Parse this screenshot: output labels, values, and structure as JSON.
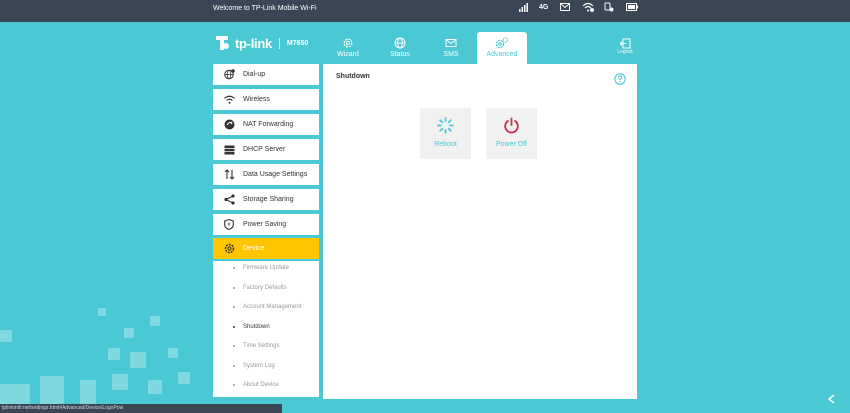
{
  "topbar": {
    "welcome": "Welcome to TP-Link Mobile Wi-Fi",
    "network": "4G",
    "icons": [
      "signal-icon",
      "mail-icon",
      "wifi-icon",
      "battery-icon"
    ]
  },
  "header": {
    "brand": "tp-link",
    "model": "M7650",
    "tabs": [
      {
        "label": "Wizard",
        "icon": "gear-icon"
      },
      {
        "label": "Status",
        "icon": "globe-icon"
      },
      {
        "label": "SMS",
        "icon": "envelope-icon"
      },
      {
        "label": "Advanced",
        "icon": "gears-icon",
        "active": true
      }
    ],
    "logout": "Logout"
  },
  "sidebar": {
    "items": [
      {
        "label": "Dial-up",
        "icon": "dialup-icon"
      },
      {
        "label": "Wireless",
        "icon": "wifi-icon"
      },
      {
        "label": "NAT Forwarding",
        "icon": "nat-icon"
      },
      {
        "label": "DHCP Server",
        "icon": "server-icon"
      },
      {
        "label": "Data Usage Settings",
        "icon": "data-arrows-icon"
      },
      {
        "label": "Storage Sharing",
        "icon": "share-icon"
      },
      {
        "label": "Power Saving",
        "icon": "shield-icon"
      },
      {
        "label": "Device",
        "icon": "gear-icon",
        "active": true
      }
    ],
    "submenu": [
      {
        "label": "Firmware Update"
      },
      {
        "label": "Factory Defaults"
      },
      {
        "label": "Account Management"
      },
      {
        "label": "Shutdown",
        "current": true
      },
      {
        "label": "Time Settings"
      },
      {
        "label": "System Log"
      },
      {
        "label": "About Device"
      }
    ]
  },
  "main": {
    "title": "Shutdown",
    "reboot_label": "Reboot",
    "poweroff_label": "Power Off"
  },
  "statusbar": {
    "url": "tplinkmifi.net/settings.html#Advanced/Device/LogoPow"
  },
  "colors": {
    "background": "#4ac8d3",
    "topbar": "#3a4654",
    "active_menu": "#ffc600",
    "accent": "#4ac8d3",
    "power_off": "#c0304f"
  }
}
